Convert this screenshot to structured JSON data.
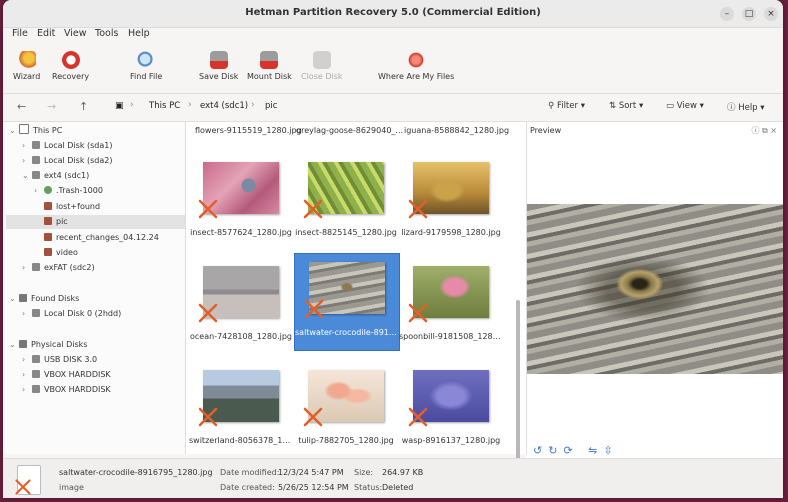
{
  "window": {
    "title": "Hetman Partition Recovery 5.0 (Commercial Edition)"
  },
  "menu": [
    "File",
    "Edit",
    "View",
    "Tools",
    "Help"
  ],
  "toolbar": {
    "wizard": "Wizard",
    "recovery": "Recovery",
    "find_file": "Find File",
    "save_disk": "Save Disk",
    "mount_disk": "Mount Disk",
    "close_disk": "Close Disk",
    "where": "Where Are My Files"
  },
  "breadcrumb": [
    "This PC",
    "ext4 (sdc1)",
    "pic"
  ],
  "navtools": {
    "filter": "Filter",
    "sort": "Sort",
    "view": "View",
    "help": "Help"
  },
  "tree": {
    "this_pc": "This PC",
    "local_a1": "Local Disk (sda1)",
    "local_a2": "Local Disk (sda2)",
    "ext4": "ext4 (sdc1)",
    "trash": ".Trash-1000",
    "lost": "lost+found",
    "pic": "pic",
    "recent": "recent_changes_04.12.24",
    "video": "video",
    "exfat": "exFAT (sdc2)",
    "found_disks": "Found Disks",
    "local0": "Local Disk 0 (2hdd)",
    "physical": "Physical Disks",
    "usb": "USB DISK 3.0",
    "vbox1": "VBOX HARDDISK",
    "vbox2": "VBOX HARDDISK"
  },
  "files": {
    "toprow": [
      "flowers-9115519_1280.jpg",
      "greylag-goose-8629040_...",
      "iguana-8588842_1280.jpg"
    ],
    "grid": [
      "insect-8577624_1280.jpg",
      "insect-8825145_1280.jpg",
      "lizard-9179598_1280.jpg",
      "ocean-7428108_1280.jpg",
      "saltwater-crocodile-8916...",
      "spoonbill-9181508_1280.j...",
      "switzerland-8056378_128...",
      "tulip-7882705_1280.jpg",
      "wasp-8916137_1280.jpg"
    ]
  },
  "preview": {
    "label": "Preview"
  },
  "status": {
    "filename": "saltwater-crocodile-8916795_1280.jpg",
    "type": "image",
    "modified_label": "Date modified:",
    "modified": "12/3/24 5:47 PM",
    "created_label": "Date created:",
    "created": "5/26/25 12:54 PM",
    "size_label": "Size:",
    "size": "264.97 KB",
    "status_label": "Status:",
    "status": "Deleted"
  },
  "colors": {
    "accent": "#4a8ad9",
    "deleted_mark": "#e0602a",
    "desktop": "#6b1f3e"
  }
}
